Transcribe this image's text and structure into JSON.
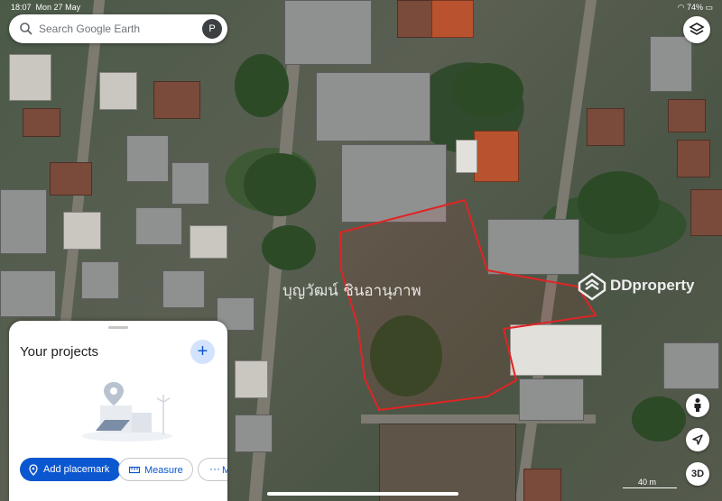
{
  "status_bar": {
    "time": "18:07",
    "date": "Mon 27 May",
    "battery": "74%"
  },
  "search": {
    "placeholder": "Search Google Earth",
    "avatar_letter": "P"
  },
  "map": {
    "parcel_label": "บุญวัฒน์ ชินอานุภาพ",
    "watermark": "DDproperty",
    "scale_label": "40 m",
    "parcel_outline_color": "#e02424"
  },
  "sheet": {
    "title": "Your projects",
    "add_placemark_label": "Add placemark",
    "measure_label": "Measure",
    "more_label": "M"
  },
  "controls": {
    "three_d_label": "3D"
  },
  "colors": {
    "primary": "#0b57d0",
    "tonal": "#d3e3fd"
  }
}
